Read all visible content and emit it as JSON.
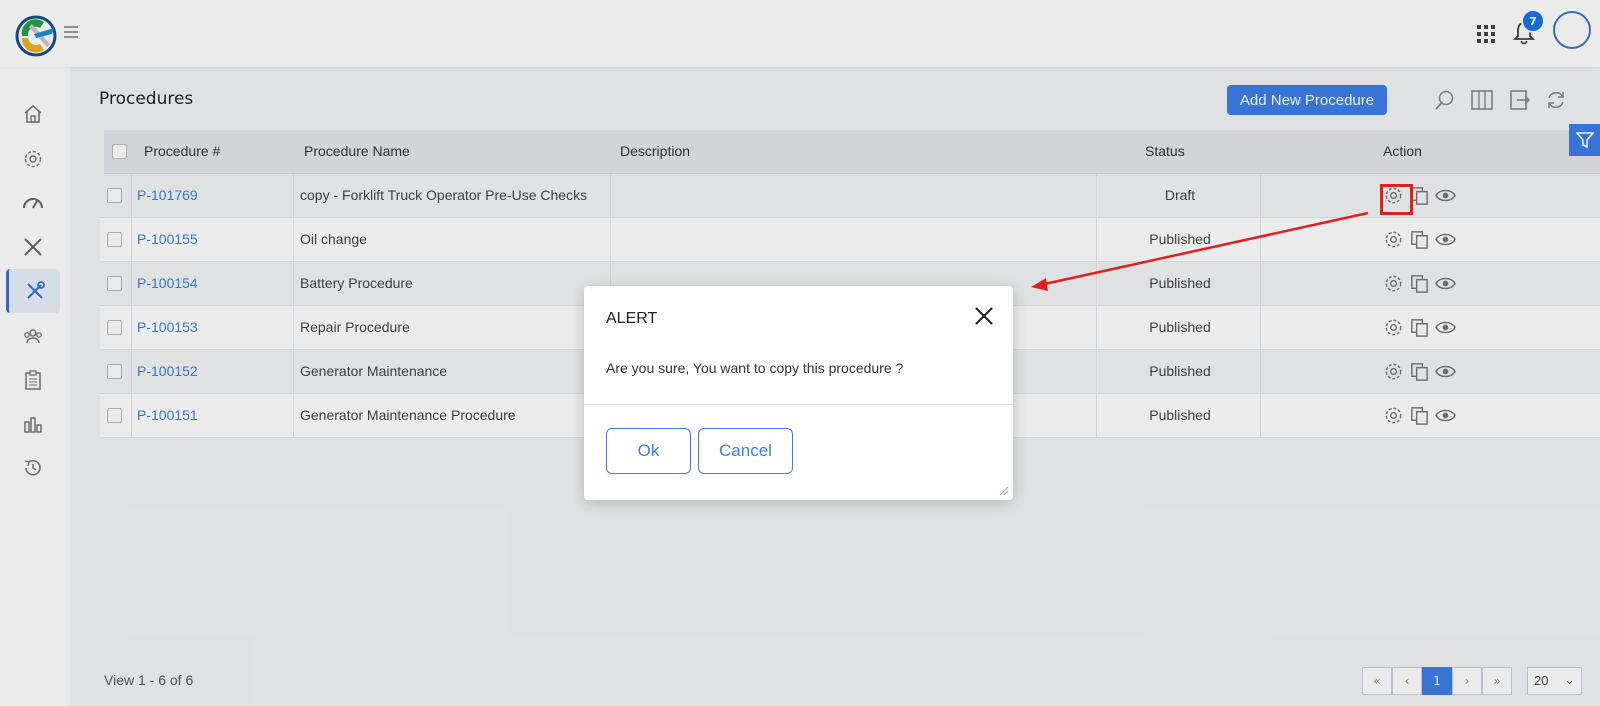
{
  "header": {
    "notification_count": "7"
  },
  "page": {
    "title": "Procedures",
    "add_button": "Add New Procedure"
  },
  "table": {
    "columns": [
      "Procedure #",
      "Procedure Name",
      "Description",
      "Status",
      "Action"
    ],
    "rows": [
      {
        "id": "P-101769",
        "name": "copy - Forklift Truck Operator Pre-Use Checks",
        "description": "",
        "status": "Draft"
      },
      {
        "id": "P-100155",
        "name": "Oil change",
        "description": "",
        "status": "Published"
      },
      {
        "id": "P-100154",
        "name": "Battery Procedure",
        "description": "",
        "status": "Published"
      },
      {
        "id": "P-100153",
        "name": "Repair Procedure",
        "description": "",
        "status": "Published"
      },
      {
        "id": "P-100152",
        "name": "Generator Maintenance",
        "description": "",
        "status": "Published"
      },
      {
        "id": "P-100151",
        "name": "Generator Maintenance Procedure",
        "description": "",
        "status": "Published"
      }
    ]
  },
  "footer": {
    "view_text": "View 1 - 6 of 6",
    "pager": {
      "first": "«",
      "prev": "‹",
      "current": "1",
      "next": "›",
      "last": "»"
    },
    "page_size": "20"
  },
  "modal": {
    "title": "ALERT",
    "message": "Are you sure, You want to copy this procedure ?",
    "ok_label": "Ok",
    "cancel_label": "Cancel"
  },
  "colors": {
    "accent": "#3d7ee8",
    "annotation_red": "#e02020"
  },
  "icons": {
    "sidebar": [
      "home-icon",
      "gear-icon",
      "gauge-icon",
      "tools-icon",
      "wrench-screwdriver-icon",
      "team-icon",
      "clipboard-icon",
      "bar-chart-icon",
      "history-icon"
    ],
    "toolbar": [
      "search-icon",
      "columns-icon",
      "export-icon",
      "refresh-icon"
    ],
    "row_actions": [
      "settings-icon",
      "copy-icon",
      "view-icon"
    ]
  }
}
